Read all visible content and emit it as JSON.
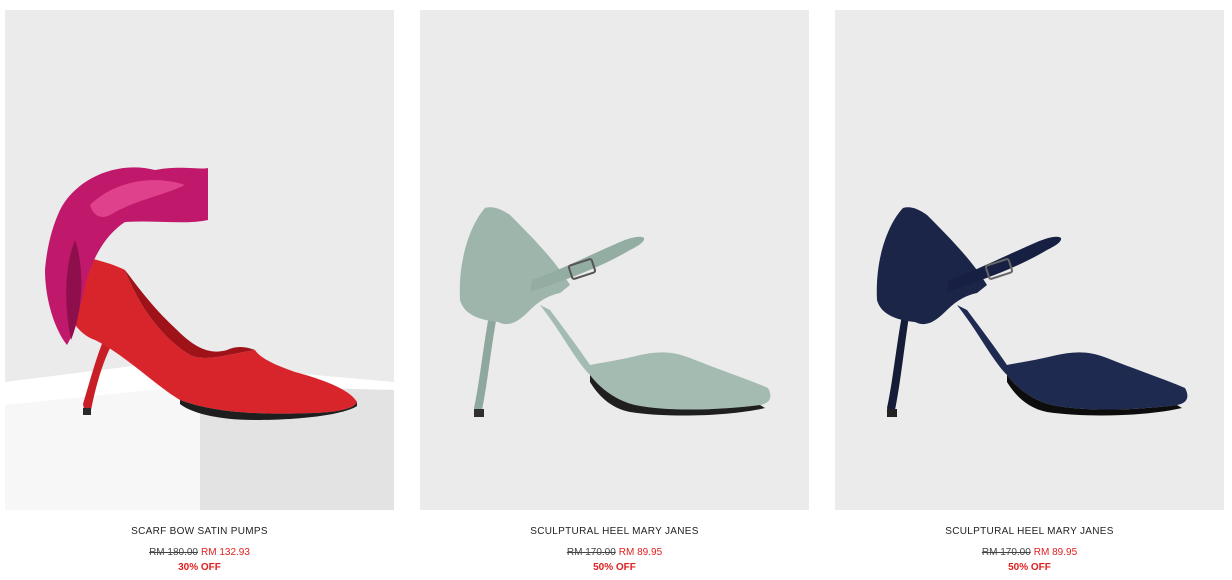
{
  "products": [
    {
      "name": "SCARF BOW SATIN PUMPS",
      "old_price": "RM 180.00",
      "new_price": "RM 132.93",
      "discount": "30% OFF",
      "image_icon": "red-satin-pump-with-pink-scarf-bow"
    },
    {
      "name": "SCULPTURAL HEEL MARY JANES",
      "old_price": "RM 170.00",
      "new_price": "RM 89.95",
      "discount": "50% OFF",
      "image_icon": "sage-green-mary-jane-heel"
    },
    {
      "name": "SCULPTURAL HEEL MARY JANES",
      "old_price": "RM 170.00",
      "new_price": "RM 89.95",
      "discount": "50% OFF",
      "image_icon": "navy-mary-jane-heel"
    }
  ],
  "colors": {
    "sale_red": "#e02020",
    "photo_bg": "#ebebeb",
    "satin_red": "#d8252c",
    "bow_pink": "#c0186a",
    "sage": "#9db5ab",
    "navy": "#1b2548"
  }
}
